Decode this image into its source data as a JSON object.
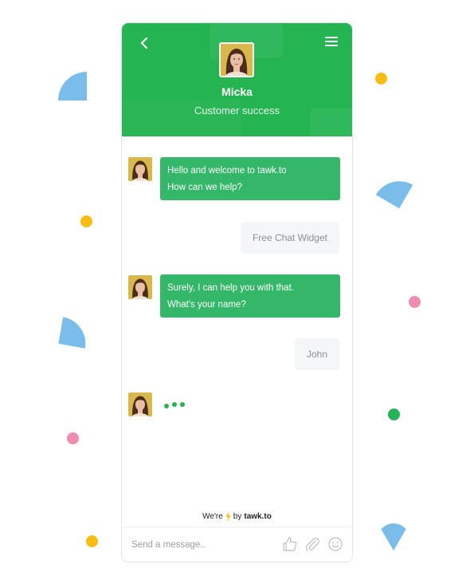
{
  "header": {
    "agent_name": "Micka",
    "agent_role": "Customer success",
    "back_icon": "chevron-left-icon",
    "menu_icon": "hamburger-menu-icon"
  },
  "messages": [
    {
      "from": "agent",
      "lines": [
        "Hello and welcome to tawk.to",
        "How can we help?"
      ]
    },
    {
      "from": "visitor",
      "text": "Free Chat Widget"
    },
    {
      "from": "agent",
      "lines": [
        "Surely, I can help you with that.",
        "What's your name?"
      ]
    },
    {
      "from": "visitor",
      "text": "John"
    },
    {
      "from": "agent",
      "typing": true
    }
  ],
  "branding": {
    "prefix": "We're",
    "by": "by",
    "brand": "tawk.to",
    "icon": "lightning-bolt-icon"
  },
  "composer": {
    "placeholder": "Send a message..",
    "icons": [
      "thumbs-up-icon",
      "paperclip-icon",
      "emoji-icon"
    ]
  },
  "colors": {
    "header_green": "#24b452",
    "bubble_green": "#34b768",
    "visitor_bubble": "#f5f6f8",
    "confetti_blue": "#7bbdea",
    "confetti_yellow": "#f7bd12",
    "confetti_pink": "#ef8cb1",
    "bolt_yellow": "#f7bd12"
  }
}
